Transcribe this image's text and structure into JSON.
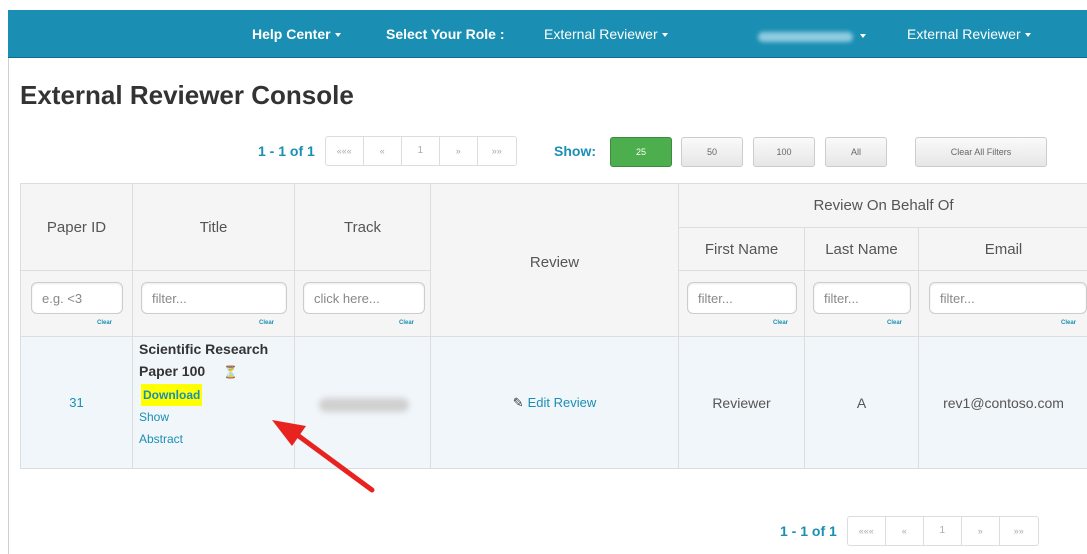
{
  "nav": {
    "help_center": "Help Center",
    "select_role_label": "Select Your Role :",
    "role": "External Reviewer",
    "user_menu": "External Reviewer"
  },
  "page_title": "External Reviewer Console",
  "pager_top": {
    "count": "1 - 1 of 1",
    "first": "«««",
    "prev": "«",
    "page": "1",
    "next": "»",
    "last": "»»"
  },
  "pager_bottom": {
    "count": "1 - 1 of 1",
    "first": "«««",
    "prev": "«",
    "page": "1",
    "next": "»",
    "last": "»»"
  },
  "show": {
    "label": "Show:",
    "options": [
      "25",
      "50",
      "100",
      "All"
    ],
    "clear_all": "Clear All Filters"
  },
  "table": {
    "headers": {
      "paper_id": "Paper ID",
      "title": "Title",
      "track": "Track",
      "review": "Review",
      "behalf_group": "Review On Behalf Of",
      "first_name": "First Name",
      "last_name": "Last Name",
      "email": "Email"
    },
    "filters": {
      "paper_id_placeholder": "e.g. <3",
      "title_placeholder": "filter...",
      "track_placeholder": "click here...",
      "first_name_placeholder": "filter...",
      "last_name_placeholder": "filter...",
      "email_placeholder": "filter...",
      "clear": "Clear"
    },
    "rows": [
      {
        "paper_id": "31",
        "title": "Scientific Research Paper 100",
        "download": "Download",
        "show_abstract": "Show Abstract",
        "edit_review": "Edit Review",
        "first_name": "Reviewer",
        "last_name": "A",
        "email": "rev1@contoso.com"
      }
    ]
  },
  "colors": {
    "nav_bg": "#1a8fb3",
    "accent": "#1a8fb3",
    "active_btn": "#4cae4c",
    "highlight": "#ffff00",
    "arrow": "#e8231f"
  }
}
